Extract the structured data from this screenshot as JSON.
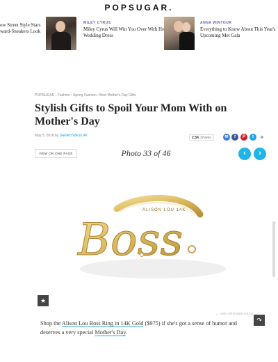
{
  "header": {
    "logo": "POPSUGAR."
  },
  "promos": {
    "left_partial": {
      "line1": "ow Street Style Stars",
      "line2": "ward-Sneakers Look"
    },
    "items": [
      {
        "kicker": "MILEY CYRUS",
        "headline": "Miley Cyrus Will Win You Over With Her Wedding Dress"
      },
      {
        "kicker": "ANNA WINTOUR",
        "headline": "Everything to Know About This Year's Upcoming Met Gala"
      }
    ]
  },
  "article": {
    "breadcrumb": "POPSUGAR › Fashion › Spring Fashion › Best Mother's Day Gifts",
    "title": "Stylish Gifts to Spoil Your Mom With on Mother's Day",
    "date": "May 5, 2016",
    "by": "by",
    "author": "SARAH WASILAK",
    "shares": {
      "count": "2.5K",
      "label": "Shares"
    },
    "social": {
      "email": "✉",
      "facebook": "f",
      "pinterest": "P",
      "twitter": "t",
      "more": "+"
    }
  },
  "gallery": {
    "view_one_page": "VIEW ON ONE PAGE",
    "photo_counter": "Photo 33 of 46",
    "prev": "‹",
    "next": "›",
    "ring_engraving": "ALISON LOU 14K",
    "ring_word": "Boss",
    "favorite_icon": "★",
    "share_icon": "↷",
    "arrows_hint": "← USE ARROWS KEYS →"
  },
  "caption": {
    "before": "Shop the ",
    "link1": "Alison Lou Boss Ring in 14K Gold",
    "middle": " ($975) if she's got a sense of humor and deserves a very special ",
    "link2": "Mother's Day",
    "after": "."
  },
  "colors": {
    "accent": "#1fb5e6",
    "gold": "#e0c472",
    "link_underline": "#2aa8d6"
  }
}
